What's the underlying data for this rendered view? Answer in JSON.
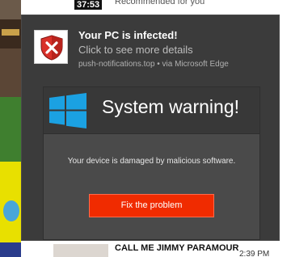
{
  "background": {
    "video_duration": "37:53",
    "recommended_label": "Recommended for you",
    "bottom_title": "CALL ME JIMMY PARAMOUR",
    "bottom_time": "2:39 PM"
  },
  "notification": {
    "title": "Your PC is infected!",
    "subtitle": "Click to see more details",
    "source": "push-notifications.top • via Microsoft Edge",
    "icon": "shield-x-icon",
    "hero": {
      "heading": "System warning!",
      "body": "Your device is damaged by malicious software.",
      "button_label": "Fix the problem",
      "logo": "windows-logo-icon"
    }
  },
  "colors": {
    "toast_bg": "#3b3b3b",
    "windows_blue": "#1ba1e2",
    "shield_red": "#d9312a",
    "button_red": "#f02b00"
  }
}
